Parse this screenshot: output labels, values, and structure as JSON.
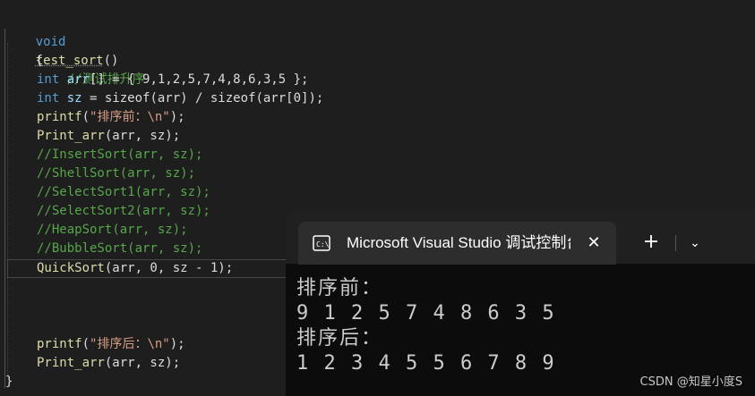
{
  "editor": {
    "lines": [
      {
        "t": "void",
        "rest_fn": "test_sort",
        "rest": "()"
      },
      {
        "t": "{"
      },
      {
        "comment": "//测试排升序"
      },
      {
        "kw": "int",
        "id": " arr",
        "rest": "[] = { 9,1,2,5,7,4,8,6,3,5 };"
      },
      {
        "kw": "int",
        "id": " sz",
        "rest": " = sizeof(arr) / sizeof(arr[0]);"
      },
      {
        "fn": "printf",
        "rest": "(",
        "str": "\"排序前：\\n\"",
        "end": ");"
      },
      {
        "fn": "Print_arr",
        "rest": "(arr, sz);"
      },
      {
        "comment": "//InsertSort(arr, sz);"
      },
      {
        "comment": "//ShellSort(arr, sz);"
      },
      {
        "comment": "//SelectSort1(arr, sz);"
      },
      {
        "comment": "//SelectSort2(arr, sz);"
      },
      {
        "comment": "//HeapSort(arr, sz);"
      },
      {
        "comment": "//BubbleSort(arr, sz);"
      },
      {
        "fn": "QuickSort",
        "rest": "(arr, 0, sz - 1);"
      },
      {
        "fn": "printf",
        "rest": "(",
        "str": "\"排序后：\\n\"",
        "end": ");"
      },
      {
        "fn": "Print_arr",
        "rest": "(arr, sz);"
      },
      {
        "t": "}"
      }
    ]
  },
  "terminal": {
    "tab_title": "Microsoft Visual Studio 调试控制台",
    "close_glyph": "✕",
    "new_tab_glyph": "+",
    "dropdown_glyph": "⌄",
    "output": [
      "排序前：",
      "9 1 2 5 7 4 8 6 3 5",
      "排序后：",
      "1 2 3 4 5 5 6 7 8 9"
    ]
  },
  "watermark": "CSDN @知星小度S",
  "colors": {
    "keyword": "#569cd6",
    "function": "#dcdcaa",
    "comment": "#57a64a",
    "string": "#d69d85",
    "terminal_bg": "#0c0c0c"
  }
}
